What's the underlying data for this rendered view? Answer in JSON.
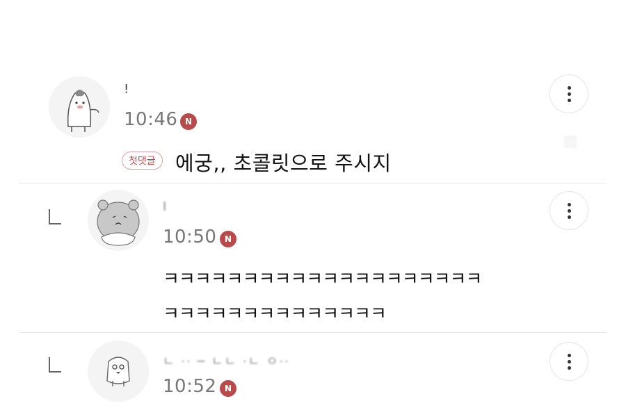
{
  "comments": [
    {
      "author": "!",
      "time": "10:46",
      "new_badge": "N",
      "first_comment_badge": "첫댓글",
      "text": "에궁,, 초콜릿으로 주시지"
    },
    {
      "author": "I",
      "time": "10:50",
      "new_badge": "N",
      "text_lines": [
        "ㅋㅋㅋㅋㅋㅋㅋㅋㅋㅋㅋㅋㅋㅋㅋㅋㅋㅋㅋㅋ",
        "ㅋㅋㅋㅋㅋㅋㅋㅋㅋㅋㅋㅋㅋㅋ"
      ]
    },
    {
      "author": "ㄴ ·· ─ ㄴㄴ  ·ㄴ ㅇ··",
      "time": "10:52",
      "new_badge": "N"
    }
  ],
  "icons": {
    "more": "more-vertical-icon",
    "reply": "reply-arrow-icon",
    "new": "new-badge-icon"
  },
  "colors": {
    "new_badge": "#b84a4a",
    "first_badge_text": "#c24a4a",
    "time_text": "#777777"
  }
}
